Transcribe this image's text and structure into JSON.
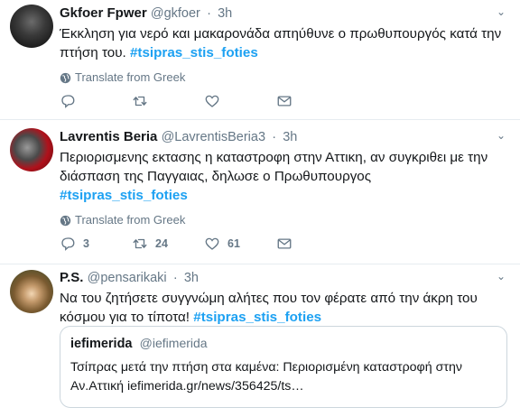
{
  "tweets": [
    {
      "name": "Gkfoer Fpwer",
      "handle": "@gkfoer",
      "time": "3h",
      "text": "Έκκληση για νερό και μακαρονάδα απηύθυνε ο πρωθυπουργός κατά την πτήση του.",
      "hashtag": "#tsipras_stis_foties",
      "translate": "Translate from Greek",
      "replies": "",
      "retweets": "",
      "likes": ""
    },
    {
      "name": "Lavrentis Beria",
      "handle": "@LavrentisBeria3",
      "time": "3h",
      "text": "Περιορισμενης εκτασης η καταστροφη στην Αττικη, αν συγκριθει με την διάσπαση της Παγγαιας, δηλωσε ο Πρωθυπουργος",
      "hashtag": "#tsipras_stis_foties",
      "translate": "Translate from Greek",
      "replies": "3",
      "retweets": "24",
      "likes": "61"
    },
    {
      "name": "P.S.",
      "handle": "@pensarikaki",
      "time": "3h",
      "text": "Να του ζητήσετε συγγνώμη αλήτες που τον φέρατε από την άκρη του κόσμου για το τίποτα!",
      "hashtag": "#tsipras_stis_foties",
      "quote": {
        "name": "iefimerida",
        "handle": "@iefimerida",
        "text": "Τσίπρας μετά την πτήση στα καμένα: Περιορισμένη καταστροφή στην Αν.Αττική iefimerida.gr/news/356425/ts…"
      }
    }
  ],
  "separator": "·",
  "icons": {
    "reply": "reply-icon",
    "retweet": "retweet-icon",
    "like": "heart-icon",
    "dm": "envelope-icon",
    "caret": "chevron-down-icon",
    "globe": "globe-icon"
  },
  "colors": {
    "hashtag": "#1da1f2",
    "secondary": "#657786",
    "border": "#e6ecf0"
  }
}
